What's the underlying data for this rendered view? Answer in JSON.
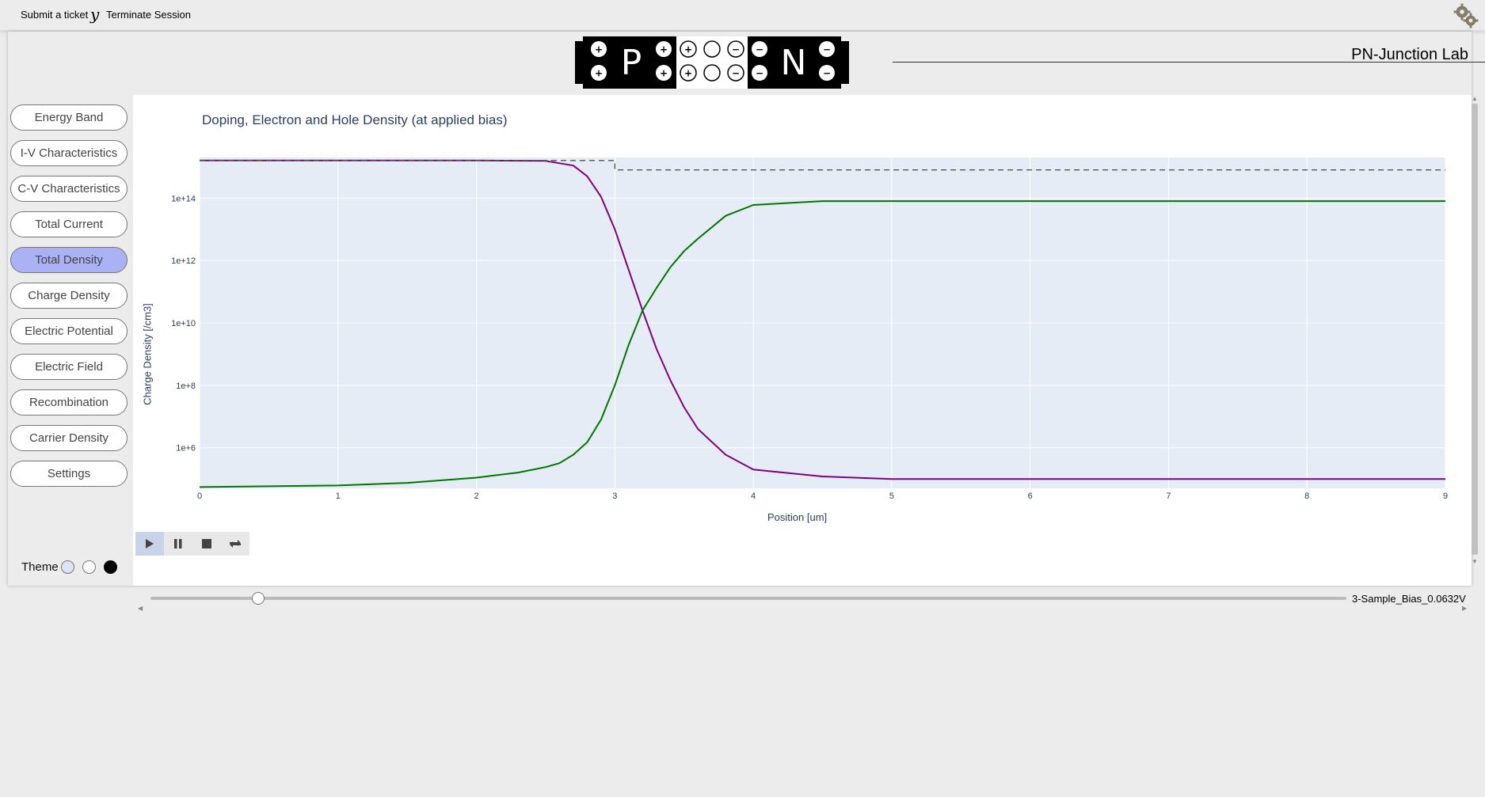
{
  "topbar": {
    "submit_ticket": "Submit a ticket",
    "separator": "y",
    "terminate": "Terminate Session",
    "settings_icon": "gear-icon"
  },
  "header": {
    "title": "PN-Junction Lab",
    "logo": {
      "p_letter": "P",
      "n_letter": "N",
      "plus": "+",
      "minus": "−"
    }
  },
  "sidebar": {
    "items": [
      {
        "label": "Energy Band",
        "active": false
      },
      {
        "label": "I-V Characteristics",
        "active": false
      },
      {
        "label": "C-V Characteristics",
        "active": false
      },
      {
        "label": "Total Current",
        "active": false
      },
      {
        "label": "Total Density",
        "active": true
      },
      {
        "label": "Charge Density",
        "active": false
      },
      {
        "label": "Electric Potential",
        "active": false
      },
      {
        "label": "Electric Field",
        "active": false
      },
      {
        "label": "Recombination",
        "active": false
      },
      {
        "label": "Carrier Density",
        "active": false
      },
      {
        "label": "Settings",
        "active": false
      }
    ],
    "active_color": "#aab1f4"
  },
  "theme": {
    "label": "Theme",
    "options": [
      {
        "name": "light-blue",
        "color": "#dde4f4"
      },
      {
        "name": "white",
        "color": "#ffffff"
      },
      {
        "name": "black",
        "color": "#000000"
      }
    ]
  },
  "animation": {
    "controls": [
      "play-icon",
      "pause-icon",
      "stop-icon",
      "loop-icon"
    ],
    "frame_label": "3-Sample_Bias_0.0632V",
    "slider_fraction": 0.09
  },
  "chart_data": {
    "type": "line",
    "title": "Doping, Electron and Hole Density (at applied bias)",
    "xlabel": "Position [um]",
    "ylabel": "Charge Density [/cm3]",
    "y_scale": "log",
    "xlim": [
      0,
      9
    ],
    "ylim_log10": [
      4.7,
      15.3
    ],
    "x_ticks": [
      "0",
      "1",
      "2",
      "3",
      "4",
      "5",
      "6",
      "7",
      "8",
      "9"
    ],
    "y_ticks": [
      "1e+6",
      "1e+8",
      "1e+10",
      "1e+12",
      "1e+14"
    ],
    "grid": true,
    "plot_bg": "#e5ecf6",
    "series": [
      {
        "color": "#800080",
        "dash": "solid",
        "x": [
          0,
          1,
          2,
          2.5,
          2.7,
          2.8,
          2.9,
          3.0,
          3.1,
          3.2,
          3.3,
          3.4,
          3.5,
          3.6,
          3.8,
          4.0,
          4.5,
          5,
          9
        ],
        "y": [
          1600000000000000.0,
          1600000000000000.0,
          1600000000000000.0,
          1550000000000000.0,
          1100000000000000.0,
          500000000000000.0,
          110000000000000.0,
          10000000000000.0,
          500000000000.0,
          25000000000.0,
          1500000000.0,
          150000000.0,
          20000000.0,
          4000000.0,
          600000.0,
          200000.0,
          120000.0,
          100000.0,
          100000.0
        ]
      },
      {
        "color": "#007700",
        "dash": "solid",
        "x": [
          0,
          1,
          1.5,
          2,
          2.3,
          2.5,
          2.6,
          2.7,
          2.8,
          2.9,
          3.0,
          3.1,
          3.2,
          3.3,
          3.4,
          3.5,
          3.6,
          3.8,
          4.0,
          4.5,
          9
        ],
        "y": [
          55000.0,
          62000.0,
          75000.0,
          110000.0,
          160000.0,
          240000.0,
          320000.0,
          600000.0,
          1500000.0,
          8000000.0,
          100000000.0,
          2000000000.0,
          25000000000.0,
          130000000000.0,
          600000000000.0,
          2000000000000.0,
          5000000000000.0,
          27000000000000.0,
          60000000000000.0,
          80000000000000.0,
          80000000000000.0
        ]
      },
      {
        "color": "#555555",
        "dash": "dashed",
        "x": [
          0,
          3.0,
          3.0,
          9
        ],
        "y": [
          1600000000000000.0,
          1600000000000000.0,
          800000000000000.0,
          800000000000000.0
        ]
      }
    ]
  }
}
